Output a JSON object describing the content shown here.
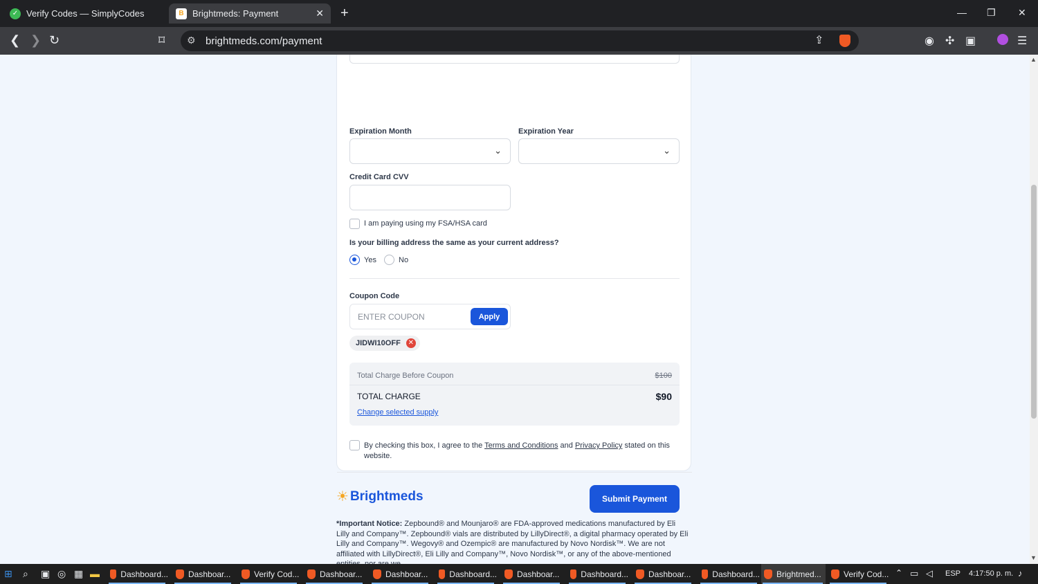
{
  "browser": {
    "tabs": [
      {
        "title": "Verify Codes — SimplyCodes",
        "icon": "simplycodes-icon"
      },
      {
        "title": "Brightmeds: Payment",
        "icon": "brightmeds-favicon",
        "active": true
      }
    ],
    "url": "brightmeds.com/payment"
  },
  "form": {
    "expiration_month_label": "Expiration Month",
    "expiration_year_label": "Expiration Year",
    "cvv_label": "Credit Card CVV",
    "fsa_label": "I am paying using my FSA/HSA card",
    "billing_question": "Is your billing address the same as your current address?",
    "billing_yes": "Yes",
    "billing_no": "No",
    "coupon_label": "Coupon Code",
    "coupon_placeholder": "ENTER COUPON",
    "apply_label": "Apply",
    "applied_coupon": "JIDWI10OFF"
  },
  "summary": {
    "before_label": "Total Charge Before Coupon",
    "before_value": "$100",
    "total_label": "TOTAL CHARGE",
    "total_value": "$90",
    "change_supply": "Change selected supply"
  },
  "terms": {
    "prefix": "By checking this box, I agree to the ",
    "terms_link": "Terms and Conditions",
    "and": " and ",
    "privacy_link": "Privacy Policy",
    "suffix": " stated on this website."
  },
  "submit_label": "Submit Payment",
  "footer": {
    "brand": "Brightmeds",
    "notice_bold": "*Important Notice:",
    "notice_text": " Zepbound® and Mounjaro® are FDA-approved medications manufactured by Eli Lilly and Company™. Zepbound® vials are distributed by LillyDirect®, a digital pharmacy operated by Eli Lilly and Company™. Wegovy® and Ozempic® are manufactured by Novo Nordisk™. We are not affiliated with LillyDirect®, Eli Lilly and Company™, Novo Nordisk™, or any of the above-mentioned entities, nor are we"
  },
  "taskbar": {
    "items": [
      "Dashboard...",
      "Dashboar...",
      "Verify Cod...",
      "Dashboar...",
      "Dashboar...",
      "Dashboard...",
      "Dashboar...",
      "Dashboard...",
      "Dashboar...",
      "Dashboard...",
      "Brightmed...",
      "Verify Cod..."
    ],
    "language": "ESP",
    "time": "4:17:50 p. m."
  }
}
